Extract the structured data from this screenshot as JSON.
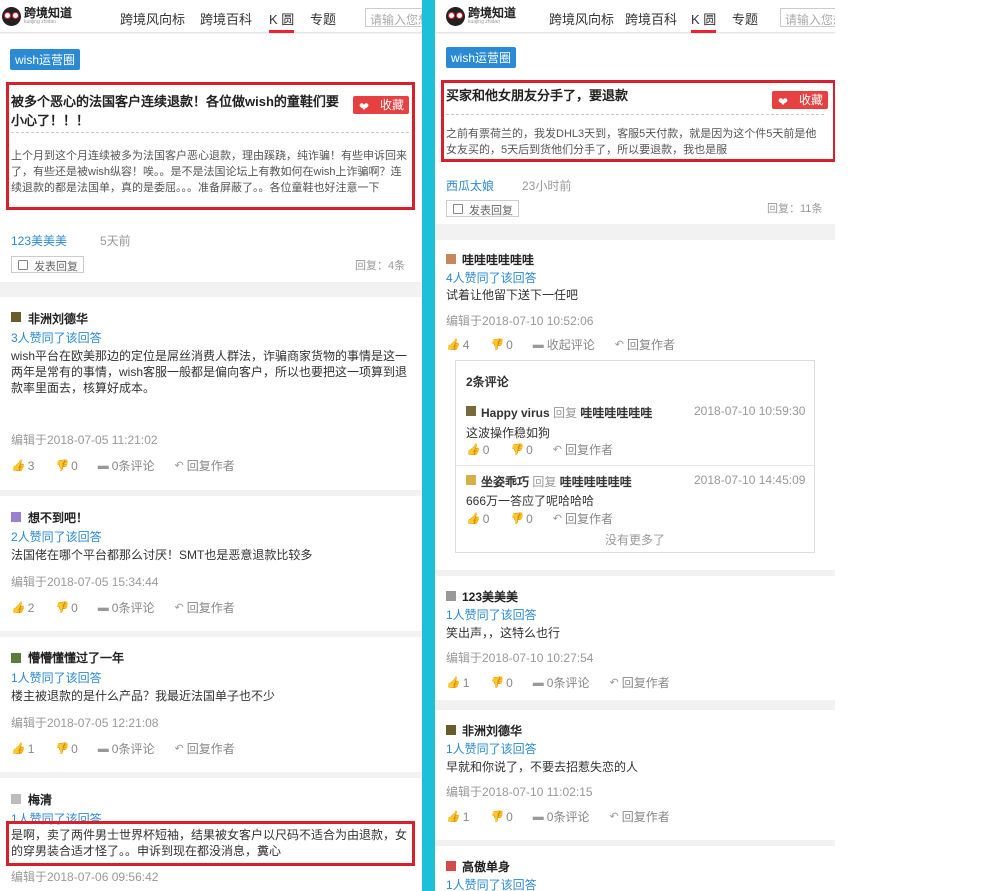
{
  "nav": {
    "logo_text": "跨境知道",
    "logo_sub": "kuajing zhidao",
    "items": [
      "跨境风向标",
      "跨境百科",
      "K 圆",
      "专题"
    ],
    "search_placeholder": "请输入您想"
  },
  "left": {
    "tag": "wish运营圈",
    "question": {
      "title": "被多个恶心的法国客户连续退款！各位做wish的童鞋们要小心了！！！",
      "fav_label": "收藏",
      "body": "上个月到这个月连续被多为法国客户恶心退款，理由蹊跷，纯诈骗！有些申诉回来了，有些还是被wish纵容！唉。。是不是法国论坛上有教如何在wish上诈骗啊？连续退款的都是法国单，真的是委屈。。。准备屏蔽了。。各位童鞋也好注意一下",
      "author": "123美美美",
      "time": "5天前",
      "reply_btn": "发表回复",
      "reply_count": "回复：4条"
    },
    "answers": [
      {
        "name": "非洲刘德华",
        "likes": "3人赞同了该回答",
        "text": "wish平台在欧美那边的定位是屌丝消费人群法，诈骗商家货物的事情是这一两年是常有的事情，wish客服一般都是偏向客户，所以也要把这一项算到退款率里面去，核算好成本。",
        "edited": "编辑于2018-07-05 11:21:02",
        "up": "3",
        "down": "0",
        "comments": "0条评论",
        "reply": "回复作者"
      },
      {
        "name": "想不到吧！",
        "likes": "2人赞同了该回答",
        "text": "法国佬在哪个平台都那么讨厌！SMT也是恶意退款比较多",
        "edited": "编辑于2018-07-05 15:34:44",
        "up": "2",
        "down": "0",
        "comments": "0条评论",
        "reply": "回复作者"
      },
      {
        "name": "懵懵懂懂过了一年",
        "likes": "1人赞同了该回答",
        "text": "楼主被退款的是什么产品？我最近法国单子也不少",
        "edited": "编辑于2018-07-05 12:21:08",
        "up": "1",
        "down": "0",
        "comments": "0条评论",
        "reply": "回复作者"
      },
      {
        "name": "梅清",
        "likes": "1人赞同了该回答",
        "text": "是啊，卖了两件男士世界杯短袖，结果被女客户以尺码不适合为由退款，女的穿男装合适才怪了。。申诉到现在都没消息，糞心",
        "edited": "编辑于2018-07-06 09:56:42"
      }
    ]
  },
  "right": {
    "tag": "wish运营圈",
    "question": {
      "title": "买家和他女朋友分手了，要退款",
      "fav_label": "收藏",
      "body": "之前有票荷兰的，我发DHL3天到，客服5天付款，就是因为这个件5天前是他女友买的，5天后到货他们分手了，所以要退款，我也是服",
      "author": "西瓜太娘",
      "time": "23小时前",
      "reply_btn": "发表回复",
      "reply_count": "回复：11条"
    },
    "answers": [
      {
        "name": "哇哇哇哇哇哇",
        "likes": "4人赞同了该回答",
        "text": "试着让他留下送下一任吧",
        "edited": "编辑于2018-07-10 10:52:06",
        "up": "4",
        "down": "0",
        "comments": "收起评论",
        "reply": "回复作者"
      },
      {
        "name": "123美美美",
        "likes": "1人赞同了该回答",
        "text": "笑出声，，这特么也行",
        "edited": "编辑于2018-07-10 10:27:54",
        "up": "1",
        "down": "0",
        "comments": "0条评论",
        "reply": "回复作者"
      },
      {
        "name": "非洲刘德华",
        "likes": "1人赞同了该回答",
        "text": "早就和你说了，不要去招惹失恋的人",
        "edited": "编辑于2018-07-10 11:02:15",
        "up": "1",
        "down": "0",
        "comments": "0条评论",
        "reply": "回复作者"
      },
      {
        "name": "高傲单身",
        "likes": "1人赞同了该回答"
      }
    ],
    "comments": {
      "title": "2条评论",
      "items": [
        {
          "name": "Happy virus",
          "mid": "回复",
          "to": "哇哇哇哇哇哇",
          "time": "2018-07-10 10:59:30",
          "text": "这波操作稳如狗",
          "up": "0",
          "down": "0",
          "reply": "回复作者"
        },
        {
          "name": "坐姿乖巧",
          "mid": "回复",
          "to": "哇哇哇哇哇哇",
          "time": "2018-07-10 14:45:09",
          "text": "666万一答应了呢哈哈哈",
          "up": "0",
          "down": "0",
          "reply": "回复作者"
        }
      ],
      "no_more": "没有更多了"
    }
  }
}
